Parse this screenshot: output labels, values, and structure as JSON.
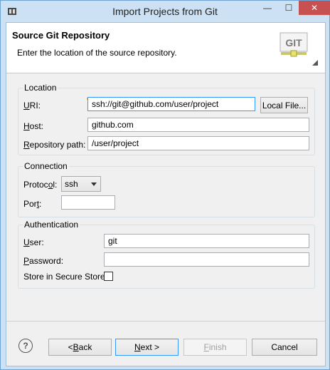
{
  "window": {
    "title": "Import Projects from Git",
    "min_glyph": "—",
    "max_glyph": "☐",
    "close_glyph": "✕"
  },
  "header": {
    "title": "Source Git Repository",
    "subtitle": "Enter the location of the source repository.",
    "logo_text": "GIT"
  },
  "location": {
    "legend": "Location",
    "uri_label": "URI:",
    "uri_value": "ssh://git@github.com/user/project",
    "local_file_button": "Local File...",
    "host_label": "Host:",
    "host_value": "github.com",
    "repo_path_label": "Repository path:",
    "repo_path_value": "/user/project"
  },
  "connection": {
    "legend": "Connection",
    "protocol_label": "Protocol:",
    "protocol_value": "ssh",
    "port_label": "Port:",
    "port_value": ""
  },
  "authentication": {
    "legend": "Authentication",
    "user_label": "User:",
    "user_value": "git",
    "password_label": "Password:",
    "password_value": "",
    "secure_store_label": "Store in Secure Store",
    "secure_store_checked": false
  },
  "footer": {
    "help_glyph": "?",
    "back_button": "< Back",
    "next_button": "Next >",
    "finish_button": "Finish",
    "cancel_button": "Cancel"
  },
  "colors": {
    "title_bar": "#cde1f4",
    "close_button": "#c75050",
    "focus_border": "#3399ff"
  }
}
